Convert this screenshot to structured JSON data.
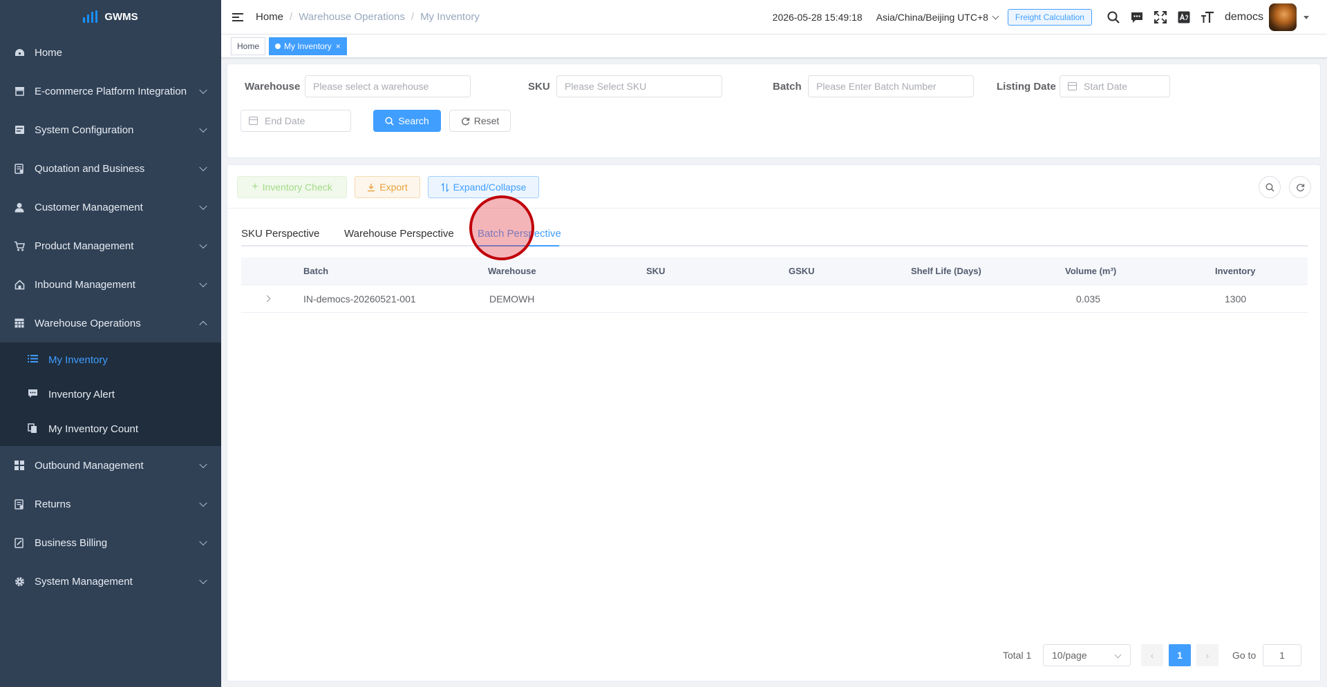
{
  "app": {
    "name": "GWMS"
  },
  "sidebar": {
    "items": [
      {
        "label": "Home",
        "icon": "dashboard-icon"
      },
      {
        "label": "E-commerce Platform Integration",
        "icon": "shop-icon"
      },
      {
        "label": "System Configuration",
        "icon": "config-icon"
      },
      {
        "label": "Quotation and Business",
        "icon": "quote-icon"
      },
      {
        "label": "Customer Management",
        "icon": "user-icon"
      },
      {
        "label": "Product Management",
        "icon": "cart-icon"
      },
      {
        "label": "Inbound Management",
        "icon": "house-icon"
      },
      {
        "label": "Warehouse Operations",
        "icon": "grid-icon"
      },
      {
        "label": "Outbound Management",
        "icon": "blocks-icon"
      },
      {
        "label": "Returns",
        "icon": "returns-icon"
      },
      {
        "label": "Business Billing",
        "icon": "billing-icon"
      },
      {
        "label": "System Management",
        "icon": "gear-icon"
      }
    ],
    "submenu": [
      {
        "label": "My Inventory",
        "icon": "list-icon"
      },
      {
        "label": "Inventory Alert",
        "icon": "message-icon"
      },
      {
        "label": "My Inventory Count",
        "icon": "copy-icon"
      }
    ]
  },
  "navbar": {
    "breadcrumb": [
      "Home",
      "Warehouse Operations",
      "My Inventory"
    ],
    "datetime": "2026-05-28 15:49:18",
    "timezone": "Asia/China/Beijing UTC+8",
    "freight_label": "Freight Calculation",
    "username": "democs"
  },
  "tags": [
    {
      "label": "Home"
    },
    {
      "label": "My Inventory",
      "close": "×"
    }
  ],
  "filters": {
    "warehouse_label": "Warehouse",
    "warehouse_placeholder": "Please select a warehouse",
    "sku_label": "SKU",
    "sku_placeholder": "Please Select SKU",
    "batch_label": "Batch",
    "batch_placeholder": "Please Enter Batch Number",
    "listing_date_label": "Listing Date",
    "start_date_placeholder": "Start Date",
    "end_date_placeholder": "End Date",
    "search_label": "Search",
    "reset_label": "Reset"
  },
  "toolbar": {
    "inventory_check": "Inventory Check",
    "export": "Export",
    "expand_collapse": "Expand/Collapse"
  },
  "tabs": [
    "SKU Perspective",
    "Warehouse Perspective",
    "Batch Perspective"
  ],
  "active_tab": "Batch Perspective",
  "table": {
    "columns": [
      "Batch",
      "Warehouse",
      "SKU",
      "GSKU",
      "Shelf Life (Days)",
      "Volume (m³)",
      "Inventory"
    ],
    "rows": [
      {
        "batch": "IN-democs-20260521-001",
        "warehouse": "DEMOWH",
        "sku": "",
        "gsku": "",
        "shelf_life": "",
        "volume": "0.035",
        "inventory": "1300"
      }
    ]
  },
  "pagination": {
    "total_text": "Total 1",
    "page_size": "10/page",
    "current_page": "1",
    "goto_label": "Go to",
    "goto_value": "1"
  },
  "colors": {
    "primary": "#409eff",
    "sidebar_bg": "#304156",
    "submenu_bg": "#1f2d3d"
  }
}
